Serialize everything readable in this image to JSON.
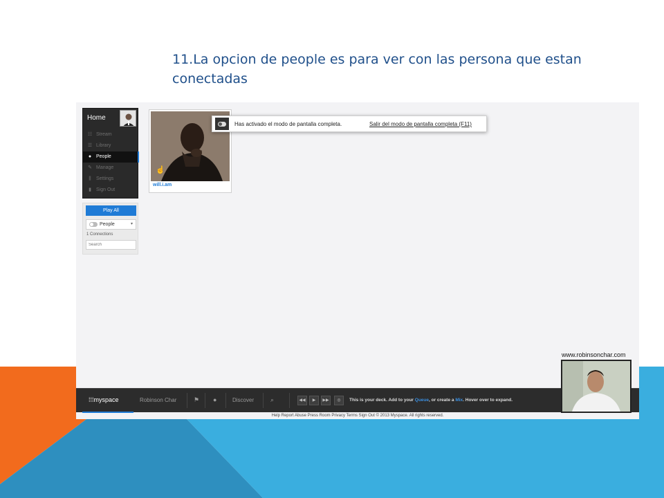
{
  "slide": {
    "title": "11.La opcion de people es para ver con las persona que estan conectadas"
  },
  "sidebar": {
    "home_label": "Home",
    "items": [
      {
        "label": "Stream",
        "icon": "stream-icon"
      },
      {
        "label": "Library",
        "icon": "library-icon"
      },
      {
        "label": "People",
        "icon": "person-icon",
        "active": true
      },
      {
        "label": "Manage",
        "icon": "wrench-icon"
      },
      {
        "label": "Settings",
        "icon": "sliders-icon"
      },
      {
        "label": "Sign Out",
        "icon": "door-icon"
      }
    ],
    "play_all": "Play All",
    "people_select": "People",
    "connections": "1 Connections",
    "search_placeholder": "Search"
  },
  "card": {
    "name": "will.i.am"
  },
  "fullscreen_notice": {
    "text": "Has activado el modo de pantalla completa.",
    "link": "Salir del modo de pantalla completa (F11)"
  },
  "deck": {
    "logo": "myspace",
    "user": "Robinson Char",
    "discover": "Discover",
    "message_prefix": "This is your deck. Add to your",
    "queue": "Queue",
    "message_middle": ", or create a",
    "mix": "Mix",
    "message_suffix": ". Hover over to expand."
  },
  "footer": {
    "links": "Help  Report Abuse  Press Room  Privacy  Terms  Sign Out  © 2013 Myspace. All rights reserved."
  },
  "webcam": {
    "label": "www.robinsonchar.com"
  },
  "colors": {
    "accent_blue": "#1f7bd6",
    "orange": "#f26b1d",
    "sky_blue": "#3aaedf",
    "title_blue": "#1f4f8a"
  }
}
